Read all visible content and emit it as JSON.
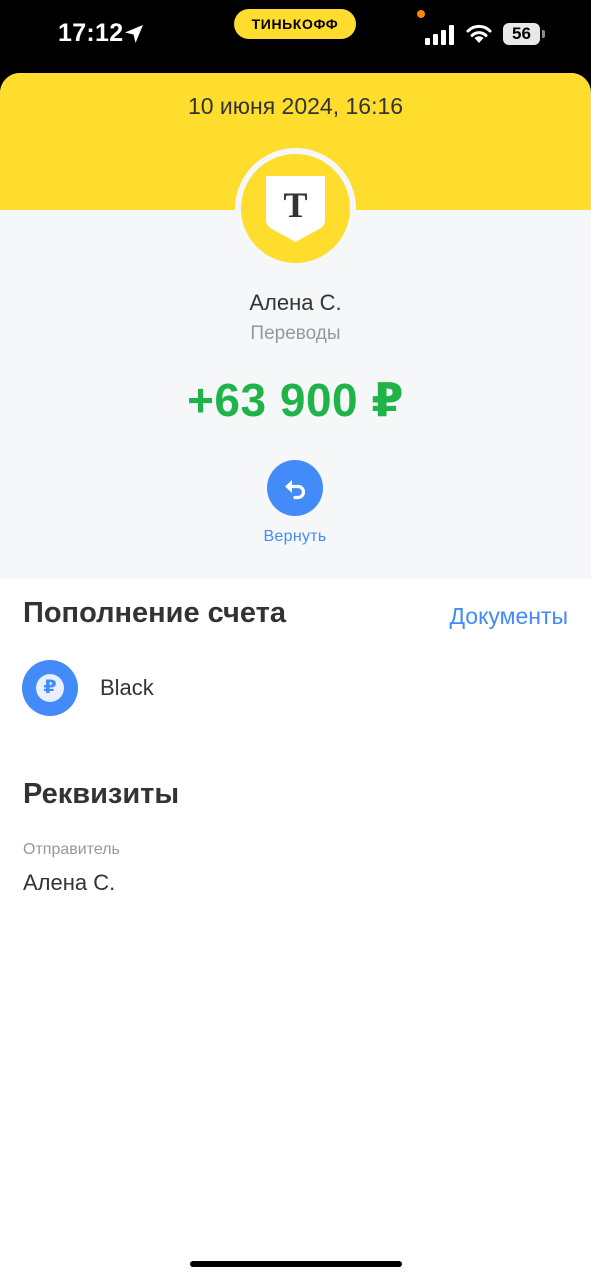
{
  "status_bar": {
    "time": "17:12",
    "carrier_pill": "ТИНЬКОФФ",
    "battery": "56"
  },
  "header": {
    "date": "10 июня 2024, 16:16",
    "logo_letter": "T",
    "sender_name": "Алена С.",
    "category": "Переводы",
    "amount": "+63 900 ₽",
    "return_label": "Вернуть"
  },
  "operation": {
    "title": "Пополнение счета",
    "documents_link": "Документы",
    "account_icon_symbol": "₽",
    "account_name": "Black"
  },
  "details": {
    "title": "Реквизиты",
    "sender_label": "Отправитель",
    "sender_value": "Алена С."
  },
  "colors": {
    "brand_yellow": "#ffdd2d",
    "amount_green": "#1fb44a",
    "accent_blue": "#428bf9",
    "header_background": "#f6f7f8",
    "secondary_text": "#9299a2",
    "primary_text": "#333333"
  }
}
